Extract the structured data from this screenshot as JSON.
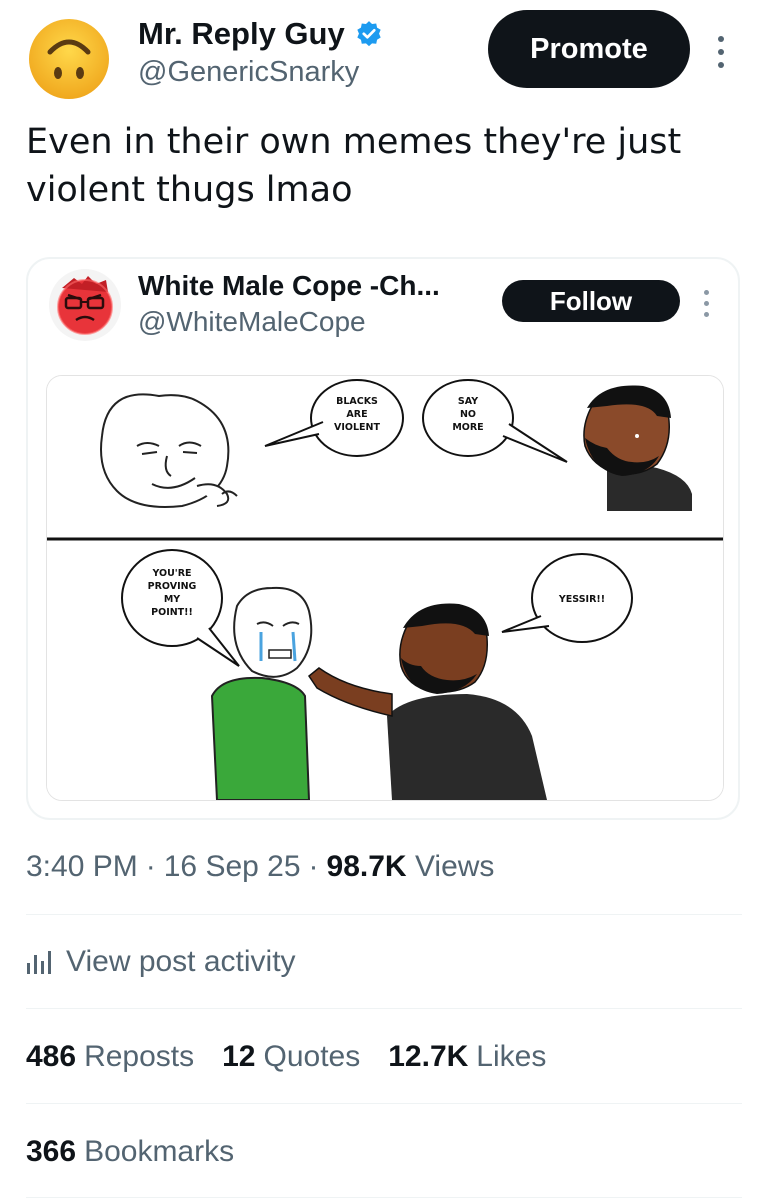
{
  "author": {
    "name": "Mr. Reply Guy",
    "handle": "@GenericSnarky",
    "verified": true,
    "avatar": "upside-down-face-emoji",
    "verified_color": "#1d9bf0"
  },
  "promote_label": "Promote",
  "tweet": {
    "text": "Even in their own memes they're just violent thugs lmao"
  },
  "quoted": {
    "name": "White Male Cope -Ch...",
    "handle": "@WhiteMaleCope",
    "follow_label": "Follow",
    "meme": {
      "panel1_bubble_left": [
        "BLACKS",
        "ARE",
        "VIOLENT"
      ],
      "panel1_bubble_right": [
        "SAY",
        "NO",
        "MORE"
      ],
      "panel2_bubble_left": [
        "YOU'RE",
        "PROVING",
        "MY",
        "POINT!!"
      ],
      "panel2_bubble_right": [
        "YESSIR!!"
      ]
    }
  },
  "meta": {
    "time": "3:40 PM",
    "sep1": "·",
    "date": "16 Sep 25",
    "sep2": "·",
    "views_count": "98.7K",
    "views_label": "Views"
  },
  "activity": {
    "icon": "analytics-bars-icon",
    "label": "View post activity"
  },
  "stats": {
    "reposts_count": "486",
    "reposts_label": "Reposts",
    "quotes_count": "12",
    "quotes_label": "Quotes",
    "likes_count": "12.7K",
    "likes_label": "Likes",
    "bookmarks_count": "366",
    "bookmarks_label": "Bookmarks"
  },
  "colors": {
    "text_primary": "#0f1419",
    "text_secondary": "#536471",
    "button_bg": "#0f1419",
    "emoji_yellow": "#f6bd31",
    "green_shirt": "#3aa83a",
    "dark_skin": "#7a3e20"
  }
}
